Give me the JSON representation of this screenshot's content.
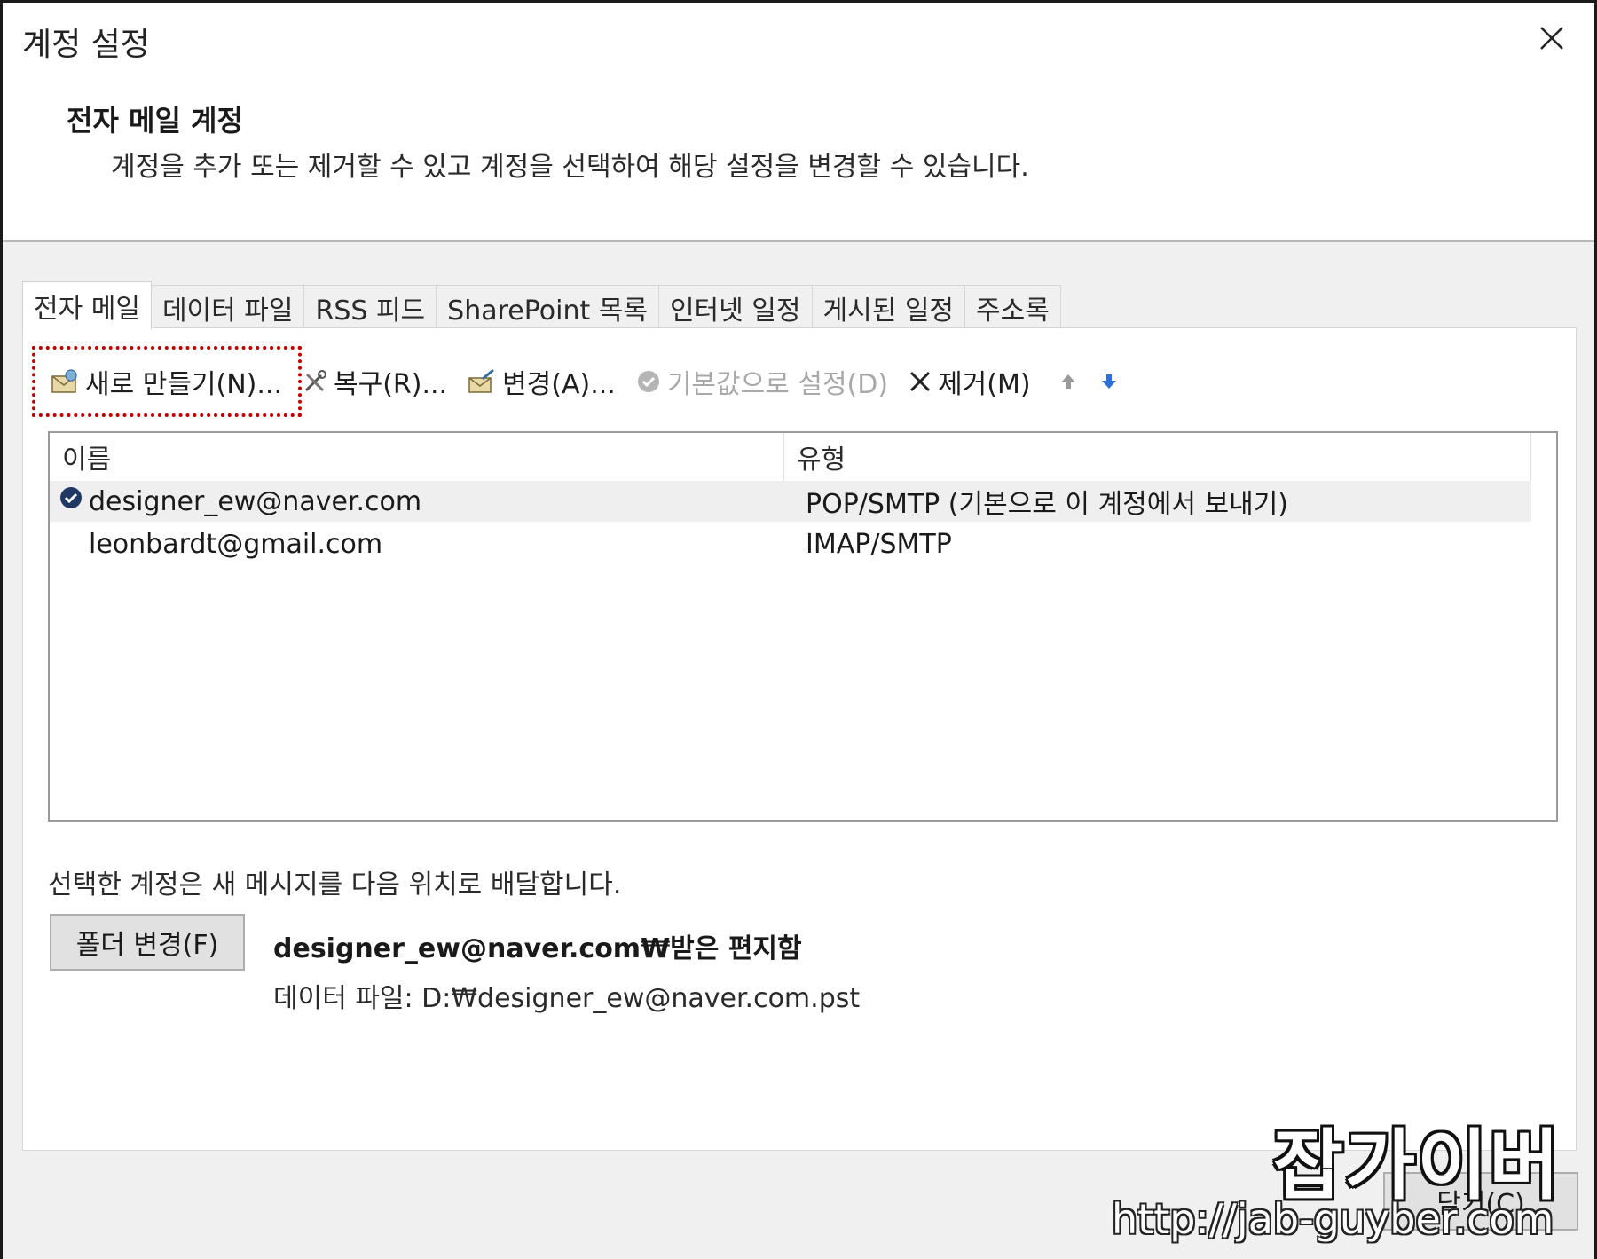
{
  "window": {
    "title": "계정 설정",
    "close_glyph": "✕"
  },
  "header": {
    "title": "전자 메일 계정",
    "description": "계정을 추가 또는 제거할 수 있고 계정을 선택하여 해당 설정을 변경할 수 있습니다."
  },
  "tabs": [
    {
      "label": "전자 메일",
      "active": true
    },
    {
      "label": "데이터 파일"
    },
    {
      "label": "RSS 피드"
    },
    {
      "label": "SharePoint 목록"
    },
    {
      "label": "인터넷 일정"
    },
    {
      "label": "게시된 일정"
    },
    {
      "label": "주소록"
    }
  ],
  "toolbar": {
    "new_label": "새로 만들기(N)...",
    "repair_label": "복구(R)...",
    "change_label": "변경(A)...",
    "set_default_label": "기본값으로 설정(D)",
    "remove_label": "제거(M)",
    "move_up_glyph": "⬆",
    "move_down_glyph": "⬇"
  },
  "accounts": {
    "columns": {
      "name": "이름",
      "type": "유형"
    },
    "rows": [
      {
        "name": "designer_ew@naver.com",
        "type": "POP/SMTP (기본으로 이 계정에서 보내기)",
        "default": true
      },
      {
        "name": "leonbardt@gmail.com",
        "type": "IMAP/SMTP"
      }
    ]
  },
  "delivery": {
    "label": "선택한 계정은 새 메시지를 다음 위치로 배달합니다.",
    "change_folder_label": "폴더 변경(F)",
    "path": "designer_ew@naver.com₩받은 편지함",
    "data_file": "데이터 파일: D:₩designer_ew@naver.com.pst"
  },
  "footer": {
    "close_label": "닫기(C)"
  },
  "watermark": {
    "logo": "잡가이버",
    "url": "http://jab-guyber.com"
  },
  "colors": {
    "highlight_border": "#c00000",
    "default_check": "#1f3864",
    "arrow_up": "#9a9a9a",
    "arrow_down": "#2e6fd8"
  }
}
